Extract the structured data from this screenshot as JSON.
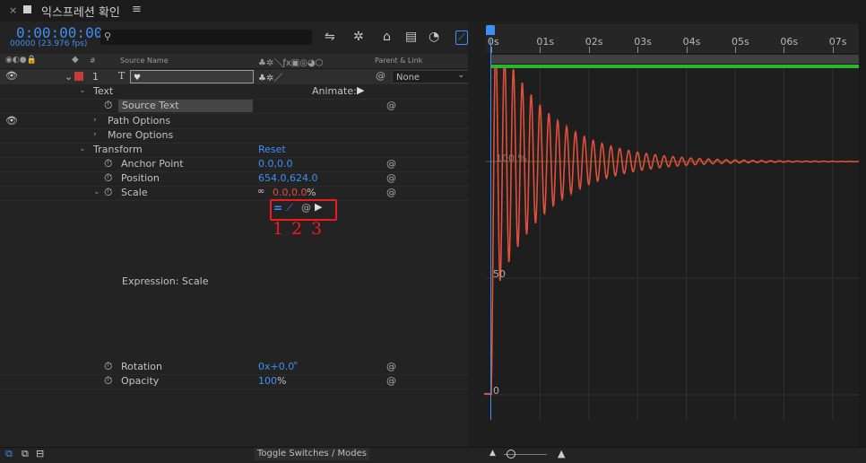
{
  "tab": {
    "close": "×",
    "title": "익스프레션 확인",
    "menu": "≡"
  },
  "time": {
    "timecode": "0:00:00:00",
    "frame_fps": "00000 (23.976 fps)"
  },
  "search": {
    "icon": "⚲",
    "placeholder": ""
  },
  "columns": {
    "label": "#",
    "source_name": "Source Name",
    "parent_link": "Parent & Link"
  },
  "layer": {
    "number": "1",
    "type_glyph": "T",
    "parent": "None"
  },
  "properties": {
    "text": "Text",
    "animate": "Animate:",
    "source_text": "Source Text",
    "path_options": "Path Options",
    "more_options": "More Options",
    "transform": "Transform",
    "reset": "Reset",
    "anchor_point": {
      "label": "Anchor Point",
      "value": "0.0,0.0"
    },
    "position": {
      "label": "Position",
      "value": "654.0,624.0"
    },
    "scale": {
      "label": "Scale",
      "value": "0.0,0.0",
      "unit": "%"
    },
    "expression_label": "Expression: Scale",
    "rotation": {
      "label": "Rotation",
      "value": "0x+0.0",
      "unit": "°"
    },
    "opacity": {
      "label": "Opacity",
      "value": "100",
      "unit": "%"
    }
  },
  "annotation": {
    "numbers": [
      "1",
      "2",
      "3"
    ]
  },
  "timeline": {
    "ticks": [
      "0s",
      "01s",
      "02s",
      "03s",
      "04s",
      "05s",
      "06s",
      "07s"
    ]
  },
  "graph": {
    "label_top": "100 %",
    "label_mid": "50",
    "label_bottom": "0"
  },
  "footer": {
    "toggle": "Toggle Switches / Modes"
  },
  "colors": {
    "accent": "#3e8ff5",
    "curve": "#e0503a",
    "green": "#2bb52b",
    "annotation": "#ee1c1c"
  }
}
